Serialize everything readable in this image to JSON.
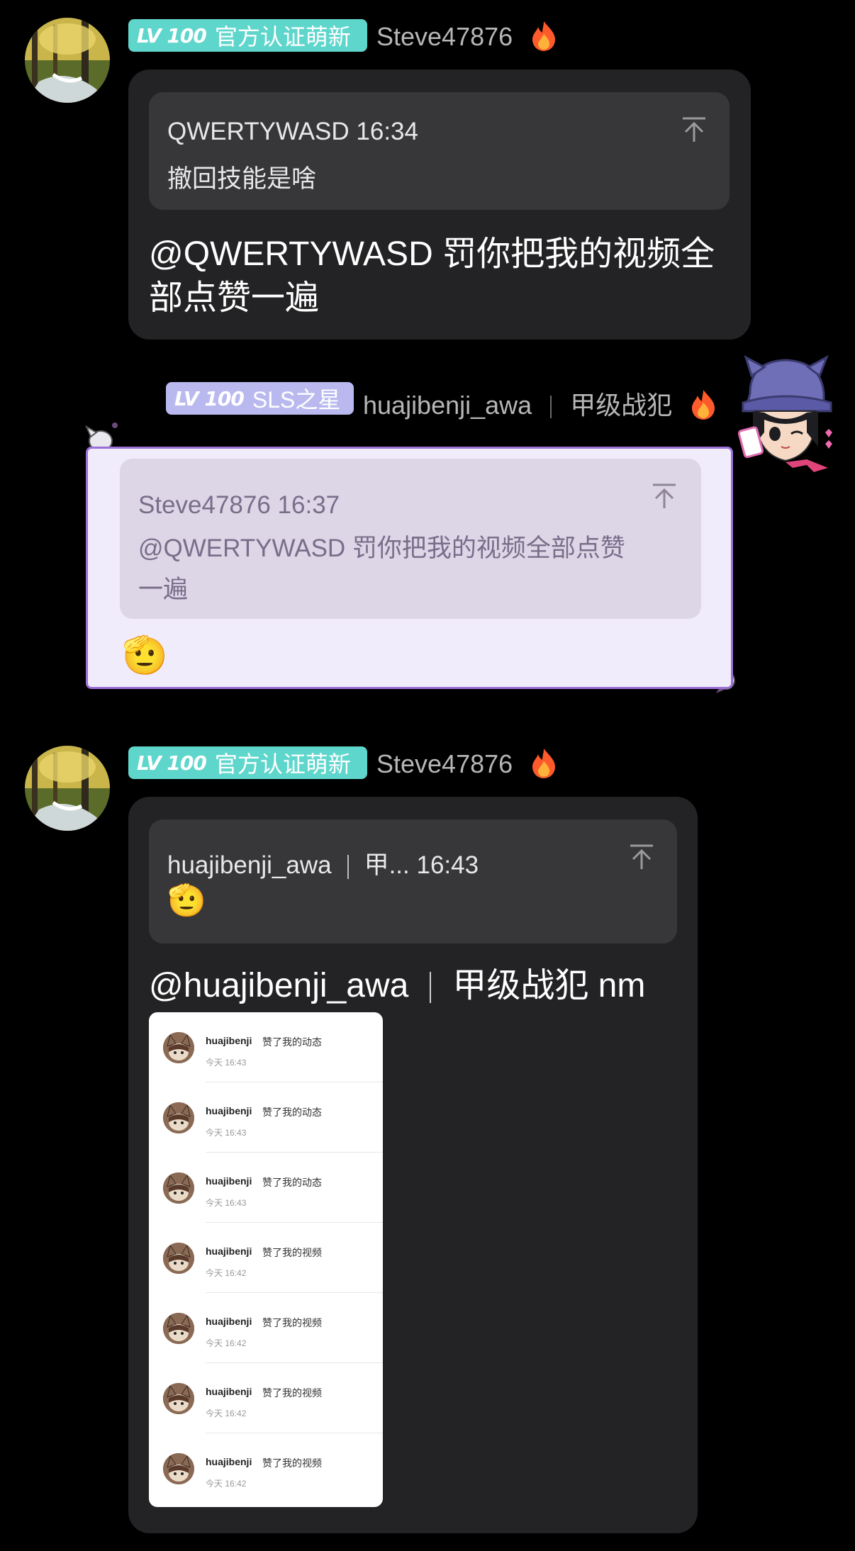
{
  "messages": [
    {
      "level_mark": "LV 100",
      "title_badge": "官方认证萌新",
      "username": "Steve47876",
      "quote": {
        "header": "QWERTYWASD 16:34",
        "body": "撤回技能是啥"
      },
      "text_line1": "@QWERTYWASD 罚你把我的视频全",
      "text_line2": "部点赞一遍"
    },
    {
      "level_mark": "LV 100",
      "title_badge": "SLS之星",
      "username": "huajibenji_awa",
      "tag": "甲级战犯",
      "quote": {
        "header": "Steve47876 16:37",
        "body_line1": "@QWERTYWASD 罚你把我的视频全部点赞",
        "body_line2": "一遍"
      },
      "emoji": "🫡"
    },
    {
      "level_mark": "LV 100",
      "title_badge": "官方认证萌新",
      "username": "Steve47876",
      "quote": {
        "header_name": "huajibenji_awa",
        "header_rest": "甲... 16:43",
        "emoji": "🫡"
      },
      "mention": "@huajibenji_awa",
      "mention_tag": "甲级战犯 nm",
      "screenshot_rows": [
        {
          "user": "huajibenji",
          "action": "赞了我的动态",
          "time": "今天 16:43"
        },
        {
          "user": "huajibenji",
          "action": "赞了我的动态",
          "time": "今天 16:43"
        },
        {
          "user": "huajibenji",
          "action": "赞了我的动态",
          "time": "今天 16:43"
        },
        {
          "user": "huajibenji",
          "action": "赞了我的视频",
          "time": "今天 16:42"
        },
        {
          "user": "huajibenji",
          "action": "赞了我的视频",
          "time": "今天 16:42"
        },
        {
          "user": "huajibenji",
          "action": "赞了我的视频",
          "time": "今天 16:42"
        },
        {
          "user": "huajibenji",
          "action": "赞了我的视频",
          "time": "今天 16:42"
        }
      ]
    }
  ],
  "colors": {
    "teal_badge": "#5fd6cc",
    "lavender_badge": "#b9b9ef",
    "bubble_dark": "#232325",
    "bubble_lavender": "#f1ecfb",
    "bubble_border": "#9a6fd6"
  },
  "icons": {
    "fire": "fire-icon",
    "jump_to_quote": "arrow-up-to-top-icon"
  }
}
